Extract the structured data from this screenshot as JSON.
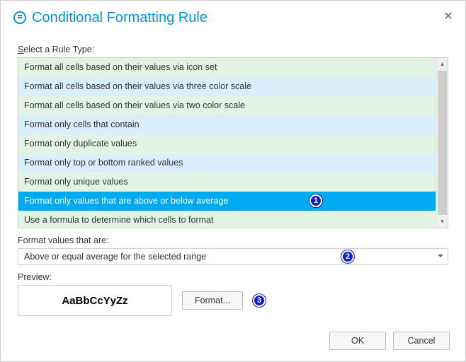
{
  "title": "Conditional Formatting Rule",
  "labels": {
    "select_rule_type_pre": "S",
    "select_rule_type_post": "elect a Rule Type:",
    "format_values": "Format values that are:",
    "preview": "Preview:"
  },
  "rule_types": [
    "Format all cells based on their values via icon set",
    "Format all cells based on their values via three color scale",
    "Format all cells based on their values via two color scale",
    "Format only cells that contain",
    "Format only duplicate values",
    "Format only top or bottom ranked values",
    "Format only unique values",
    "Format only values that are above or below average",
    "Use a formula to determine which cells to format"
  ],
  "selected_rule_index": 7,
  "format_values_dropdown": {
    "selected": "Above or equal average for the selected range"
  },
  "preview_sample": "AaBbCcYyZz",
  "buttons": {
    "format": "Format...",
    "ok": "OK",
    "cancel": "Cancel"
  },
  "annotations": {
    "a1": "1",
    "a2": "2",
    "a3": "3"
  }
}
